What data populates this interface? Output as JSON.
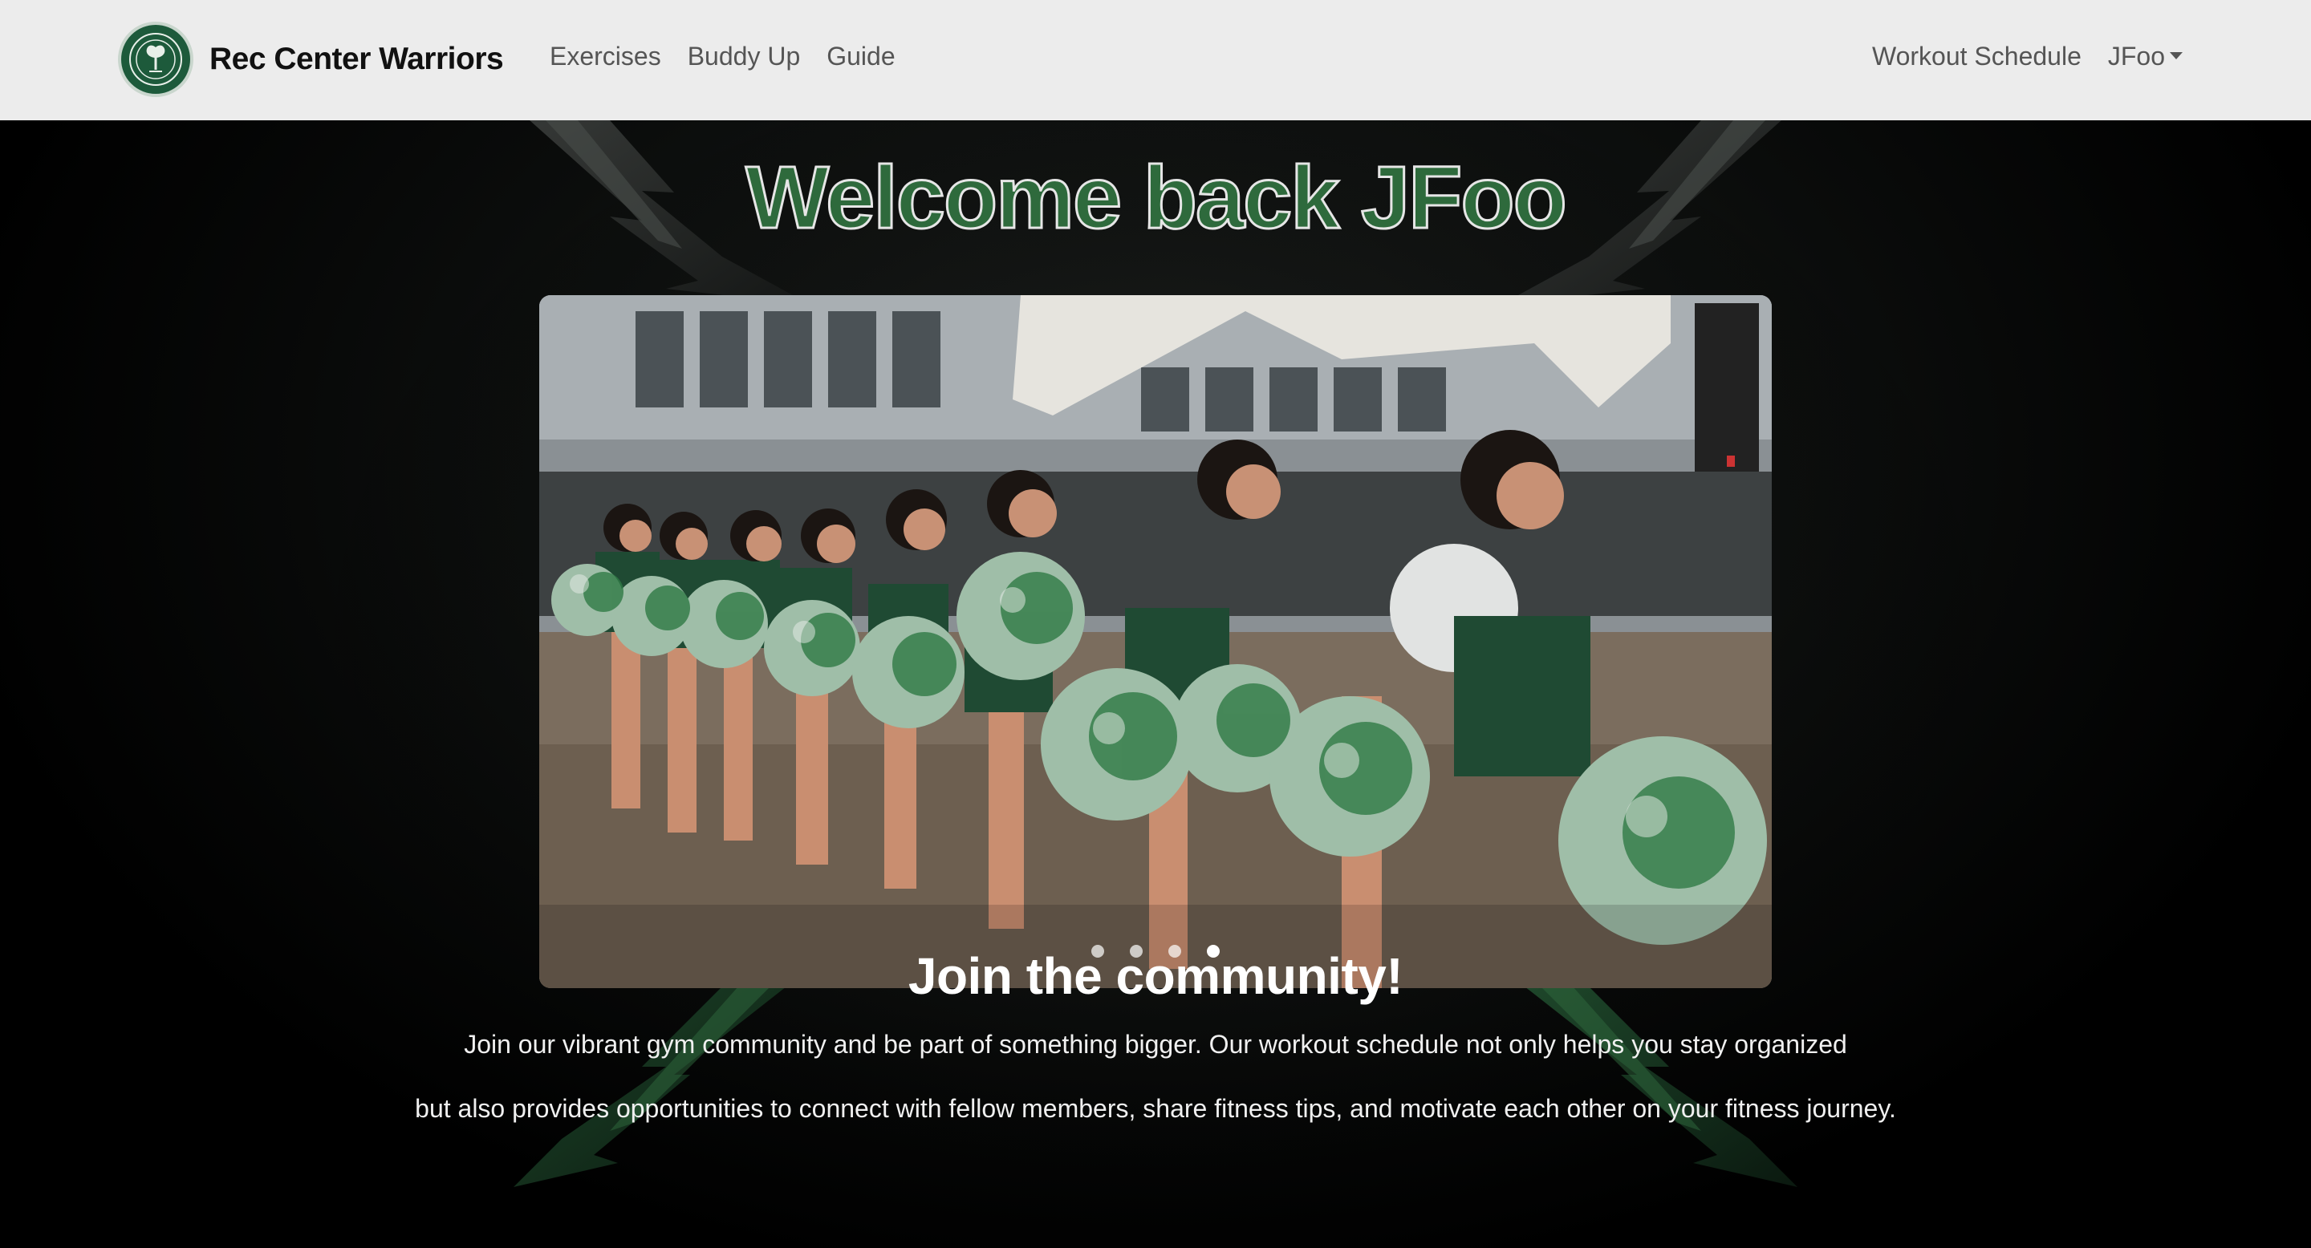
{
  "navbar": {
    "brand_name": "Rec Center Warriors",
    "logo_icon": "tree-seal-logo",
    "left_links": [
      "Exercises",
      "Buddy Up",
      "Guide"
    ],
    "right_links": {
      "schedule": "Workout Schedule",
      "user_menu": "JFoo"
    }
  },
  "hero": {
    "welcome_text": "Welcome back JFoo"
  },
  "carousel": {
    "image_description_icon": "cheerleaders-photo",
    "slide_count": 4,
    "active_slide": 4
  },
  "community": {
    "title": "Join the community!",
    "line1": "Join our vibrant gym community and be part of something bigger. Our workout schedule not only helps you stay organized",
    "line2": "but also provides opportunities to connect with fellow members, share fitness tips, and motivate each other on your fitness journey."
  },
  "colors": {
    "brand_green": "#1d5a3b",
    "welcome_fill": "#2e6a3c",
    "navbar_bg": "#ececec"
  }
}
